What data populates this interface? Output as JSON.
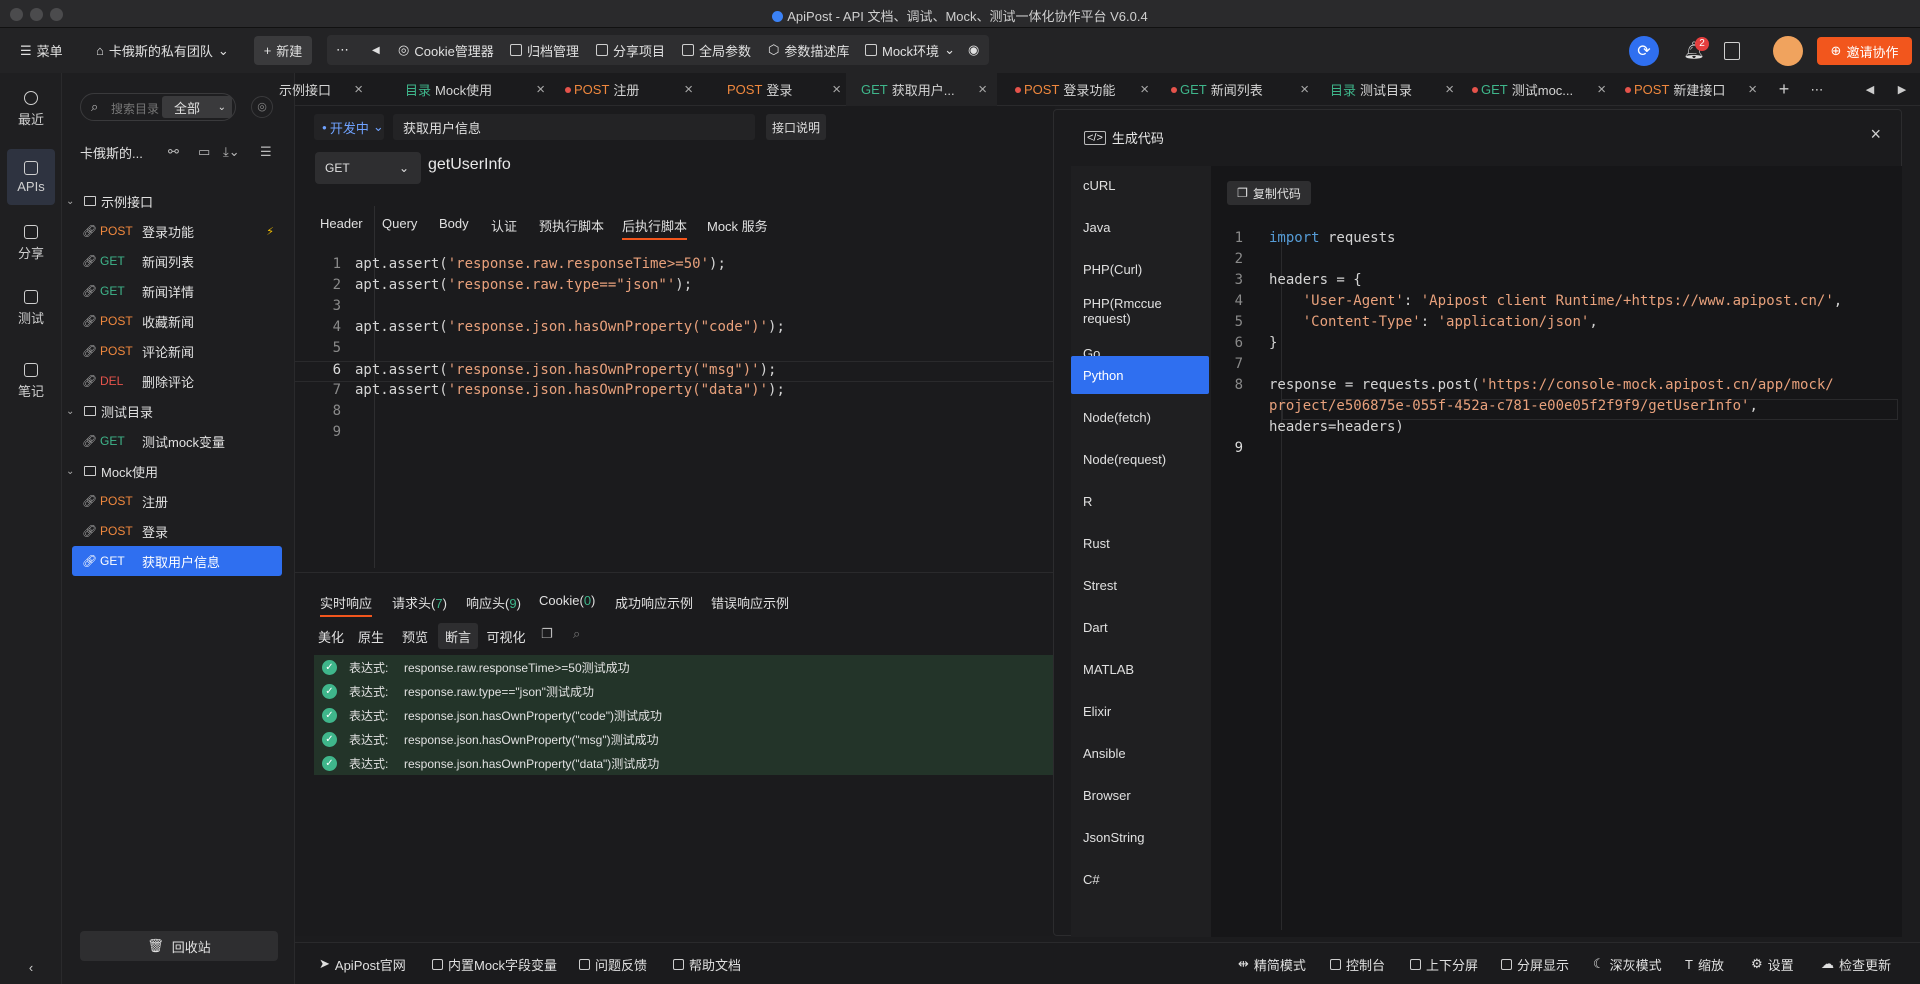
{
  "window": {
    "title": "ApiPost - API 文档、调试、Mock、测试一体化协作平台 V6.0.4"
  },
  "toolbar": {
    "menu": "菜单",
    "team": "卡俄斯的私有团队",
    "new": "新建",
    "items": [
      "Cookie管理器",
      "归档管理",
      "分享项目",
      "全局参数",
      "参数描述库",
      "Mock环境"
    ],
    "notification_count": "2",
    "invite": "邀请协作"
  },
  "rail": {
    "items": [
      "最近",
      "APIs",
      "分享",
      "测试",
      "笔记"
    ]
  },
  "tree": {
    "search_placeholder": "搜索目录",
    "filter": "全部",
    "project": "卡俄斯的...",
    "folders": [
      {
        "name": "示例接口",
        "items": [
          {
            "method": "POST",
            "name": "登录功能"
          },
          {
            "method": "GET",
            "name": "新闻列表"
          },
          {
            "method": "GET",
            "name": "新闻详情"
          },
          {
            "method": "POST",
            "name": "收藏新闻"
          },
          {
            "method": "POST",
            "name": "评论新闻"
          },
          {
            "method": "DEL",
            "name": "删除评论"
          }
        ]
      },
      {
        "name": "测试目录",
        "items": [
          {
            "method": "GET",
            "name": "测试mock变量"
          }
        ]
      },
      {
        "name": "Mock使用",
        "items": [
          {
            "method": "POST",
            "name": "注册"
          },
          {
            "method": "POST",
            "name": "登录"
          },
          {
            "method": "GET",
            "name": "获取用户信息"
          }
        ]
      }
    ],
    "recycle": "回收站"
  },
  "tabs": [
    {
      "prefix": "",
      "name": "示例接口"
    },
    {
      "prefix": "目录",
      "name": "Mock使用"
    },
    {
      "prefix": "POST",
      "name": "注册"
    },
    {
      "prefix": "POST",
      "name": "登录"
    },
    {
      "prefix": "GET",
      "name": "获取用户..."
    },
    {
      "prefix": "POST",
      "name": "登录功能"
    },
    {
      "prefix": "GET",
      "name": "新闻列表"
    },
    {
      "prefix": "目录",
      "name": "测试目录"
    },
    {
      "prefix": "GET",
      "name": "测试moc..."
    },
    {
      "prefix": "POST",
      "name": "新建接口"
    }
  ],
  "request": {
    "env": "开发中",
    "name": "获取用户信息",
    "doc_button": "接口说明",
    "method": "GET",
    "url": "getUserInfo",
    "tabs": [
      "Header",
      "Query",
      "Body",
      "认证",
      "预执行脚本",
      "后执行脚本",
      "Mock 服务"
    ],
    "script_lines": [
      [
        "apt.assert(",
        "'response.raw.responseTime>=50'",
        ");"
      ],
      [
        "apt.assert(",
        "'response.raw.type==\"json\"'",
        ");"
      ],
      [
        "",
        "",
        ""
      ],
      [
        "apt.assert(",
        "'response.json.hasOwnProperty(\"code\")'",
        ");"
      ],
      [
        "",
        "",
        ""
      ],
      [
        "apt.assert(",
        "'response.json.hasOwnProperty(\"msg\")'",
        ");"
      ],
      [
        "apt.assert(",
        "'response.json.hasOwnProperty(\"data\")'",
        ");"
      ],
      [
        "",
        "",
        ""
      ],
      [
        "",
        "",
        ""
      ]
    ]
  },
  "response": {
    "tabs": [
      {
        "label": "实时响应",
        "count": ""
      },
      {
        "label": "请求头",
        "count": "7"
      },
      {
        "label": "响应头",
        "count": "9"
      },
      {
        "label": "Cookie",
        "count": "0"
      },
      {
        "label": "成功响应示例",
        "count": ""
      },
      {
        "label": "错误响应示例",
        "count": ""
      }
    ],
    "view_tabs": [
      "美化",
      "原生",
      "预览",
      "断言",
      "可视化"
    ],
    "assert_label": "表达式:",
    "asserts": [
      "response.raw.responseTime>=50测试成功",
      "response.raw.type==\"json\"测试成功",
      "response.json.hasOwnProperty(\"code\")测试成功",
      "response.json.hasOwnProperty(\"msg\")测试成功",
      "response.json.hasOwnProperty(\"data\")测试成功"
    ]
  },
  "codegen": {
    "title": "生成代码",
    "copy": "复制代码",
    "languages": [
      "cURL",
      "Java",
      "PHP(Curl)",
      "PHP(Rmccue request)",
      "Go",
      "Python",
      "Node(fetch)",
      "Node(request)",
      "R",
      "Rust",
      "Strest",
      "Dart",
      "MATLAB",
      "Elixir",
      "Ansible",
      "Browser",
      "JsonString",
      "C#"
    ],
    "active_language": "Python"
  },
  "statusbar": {
    "left": [
      "ApiPost官网",
      "内置Mock字段变量",
      "问题反馈",
      "帮助文档"
    ],
    "right": [
      "精简模式",
      "控制台",
      "上下分屏",
      "分屏显示",
      "深灰模式",
      "缩放",
      "设置",
      "检查更新"
    ]
  }
}
